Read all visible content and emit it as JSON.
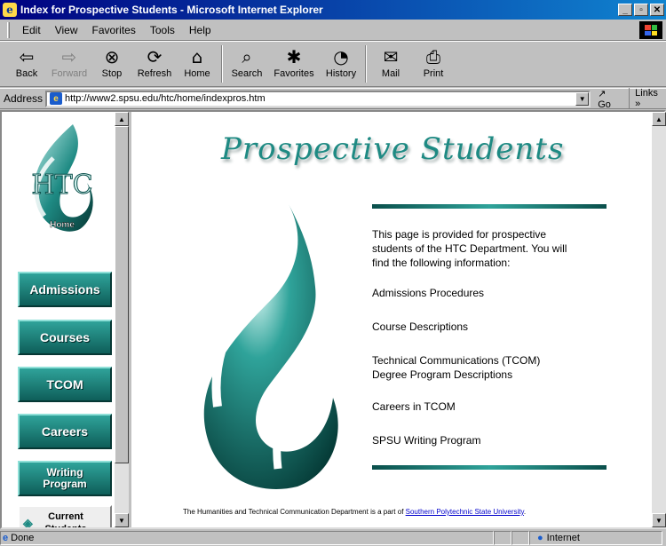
{
  "window": {
    "title": "Index for Prospective Students - Microsoft Internet Explorer"
  },
  "menu": {
    "items": [
      "Edit",
      "View",
      "Favorites",
      "Tools",
      "Help"
    ]
  },
  "toolbar": {
    "back": "Back",
    "forward": "Forward",
    "stop": "Stop",
    "refresh": "Refresh",
    "home": "Home",
    "search": "Search",
    "favorites": "Favorites",
    "history": "History",
    "mail": "Mail",
    "print": "Print"
  },
  "address": {
    "label": "Address",
    "url": "http://www2.spsu.edu/htc/home/indexpros.htm",
    "go": "Go",
    "links": "Links"
  },
  "sidebar": {
    "logo_text": "HTC",
    "home_label": "Home",
    "items": [
      {
        "label": "Admissions"
      },
      {
        "label": "Courses"
      },
      {
        "label": "TCOM"
      },
      {
        "label": "Careers"
      },
      {
        "label": "Writing Program"
      },
      {
        "label": "Current Students"
      }
    ]
  },
  "main": {
    "title": "Prospective Students",
    "intro": "This page is provided for prospective students of the HTC Department. You will find the following information:",
    "links": [
      "Admissions Procedures",
      "Course Descriptions",
      "Technical Communications (TCOM) Degree Program Descriptions",
      "Careers in TCOM",
      "SPSU Writing Program"
    ],
    "footer_text": "The Humanities and Technical Communication Department is a part of ",
    "footer_link": "Southern Polytechnic State University",
    "footer_end": "."
  },
  "status": {
    "text": "Done",
    "zone": "Internet"
  },
  "colors": {
    "teal": "#1e8a83",
    "titlebar": "#000080"
  }
}
